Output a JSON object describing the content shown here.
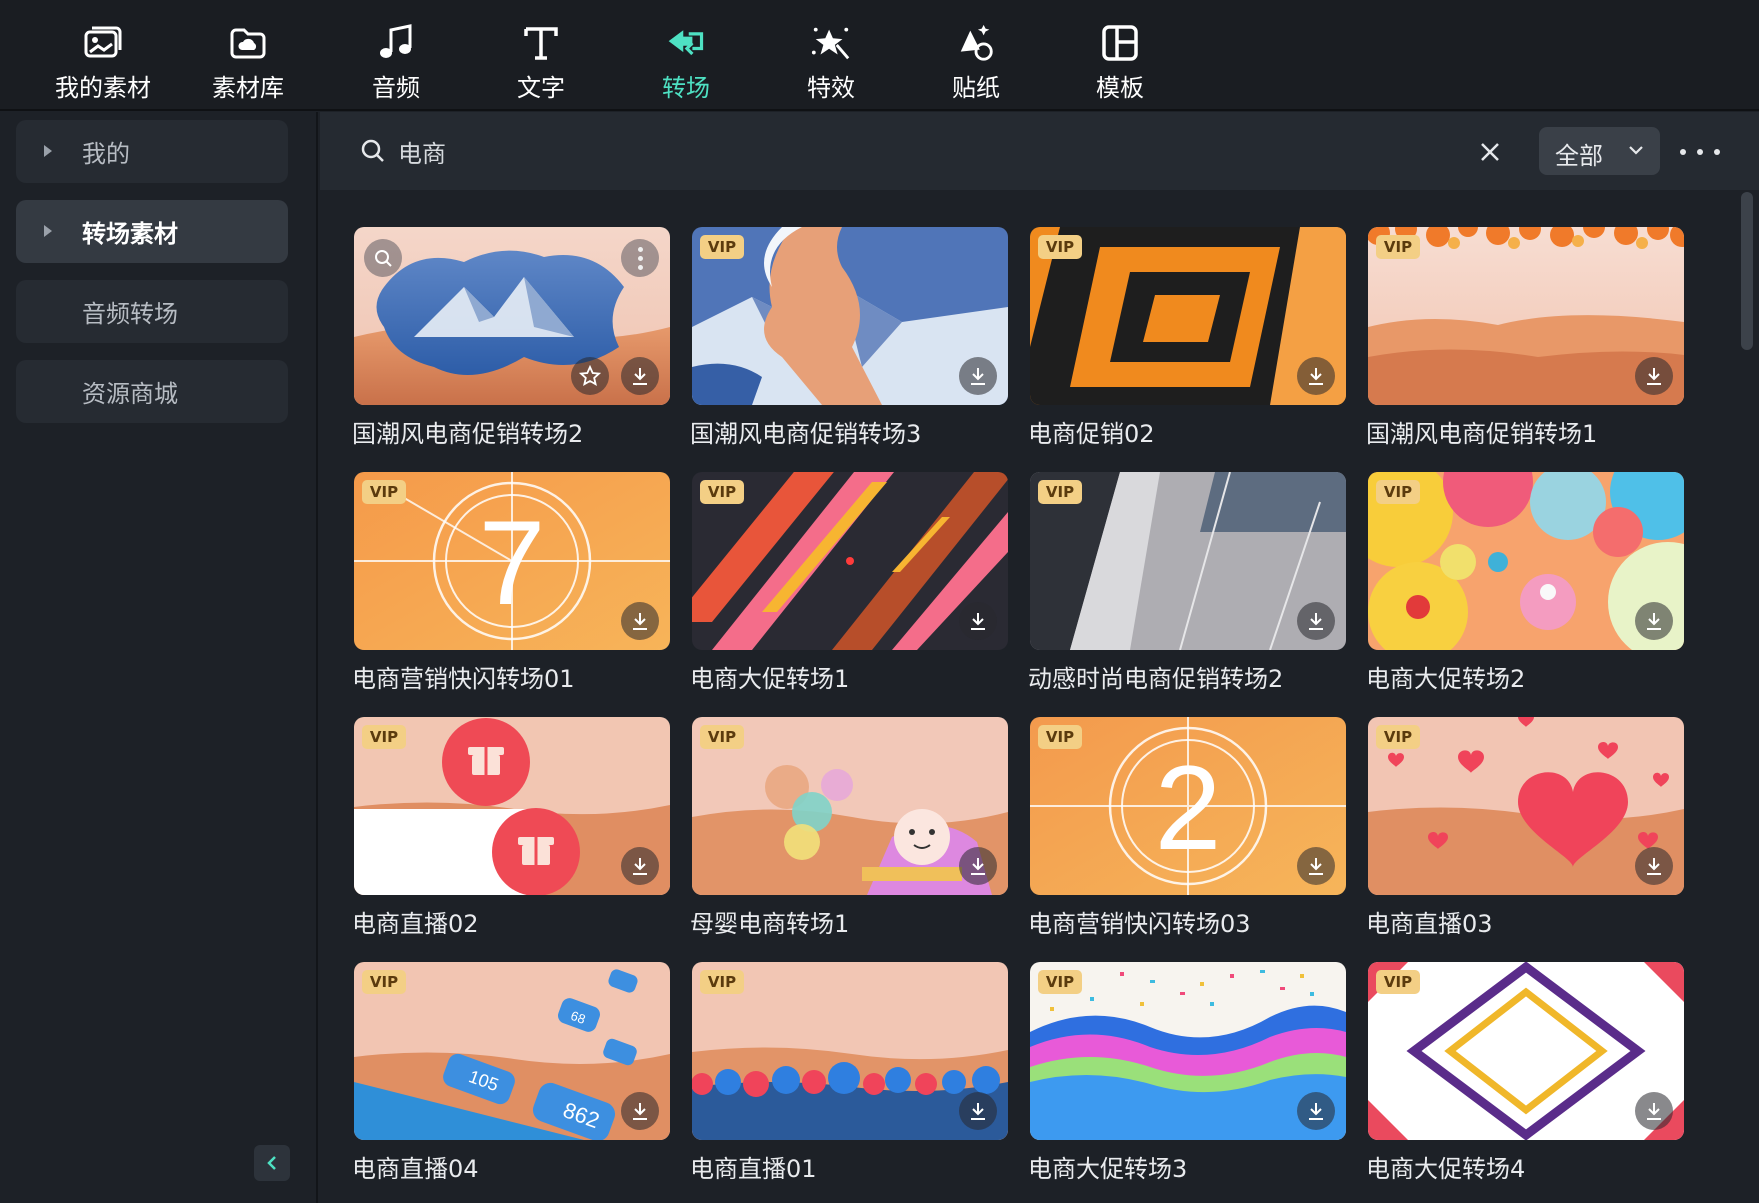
{
  "toolbar": {
    "tabs": [
      {
        "label": "我的素材",
        "icon": "my-media-icon"
      },
      {
        "label": "素材库",
        "icon": "stock-library-icon"
      },
      {
        "label": "音频",
        "icon": "music-note-icon"
      },
      {
        "label": "文字",
        "icon": "text-icon"
      },
      {
        "label": "转场",
        "icon": "transition-icon",
        "active": true
      },
      {
        "label": "特效",
        "icon": "magic-effects-icon"
      },
      {
        "label": "贴纸",
        "icon": "sticker-icon"
      },
      {
        "label": "模板",
        "icon": "template-icon"
      }
    ],
    "active_color": "#4ee1c3"
  },
  "sidebar": {
    "items": [
      {
        "label": "我的",
        "expandable": true
      },
      {
        "label": "转场素材",
        "expandable": true,
        "active": true
      },
      {
        "label": "音频转场"
      },
      {
        "label": "资源商城"
      }
    ]
  },
  "search": {
    "value": "电商",
    "filter": "全部"
  },
  "badge": {
    "vip": "VIP",
    "vip_color": "#f3cf85"
  },
  "items": [
    {
      "name": "国潮风电商促销转场2",
      "vip": false,
      "theme": "mountain-desert"
    },
    {
      "name": "国潮风电商促销转场3",
      "vip": true,
      "theme": "mountain-split"
    },
    {
      "name": "电商促销02",
      "vip": true,
      "theme": "orange-squares"
    },
    {
      "name": "国潮风电商促销转场1",
      "vip": true,
      "theme": "desert-flowers"
    },
    {
      "name": "电商营销快闪转场01",
      "vip": true,
      "theme": "countdown-7"
    },
    {
      "name": "电商大促转场1",
      "vip": true,
      "theme": "diagonal-stripes"
    },
    {
      "name": "动感时尚电商促销转场2",
      "vip": true,
      "theme": "grey-shards"
    },
    {
      "name": "电商大促转场2",
      "vip": true,
      "theme": "color-bubbles"
    },
    {
      "name": "电商直播02",
      "vip": true,
      "theme": "gift-boxes"
    },
    {
      "name": "母婴电商转场1",
      "vip": true,
      "theme": "baby-balloons"
    },
    {
      "name": "电商营销快闪转场03",
      "vip": true,
      "theme": "countdown-2"
    },
    {
      "name": "电商直播03",
      "vip": true,
      "theme": "hearts"
    },
    {
      "name": "电商直播04",
      "vip": true,
      "theme": "social-bubbles"
    },
    {
      "name": "电商直播01",
      "vip": true,
      "theme": "like-reactions"
    },
    {
      "name": "电商大促转场3",
      "vip": true,
      "theme": "confetti-waves"
    },
    {
      "name": "电商大促转场4",
      "vip": true,
      "theme": "diamond-frames"
    }
  ],
  "item_text": {
    "countdown_7": "7",
    "countdown_2": "2",
    "bubble_68": "68",
    "bubble_105": "105",
    "bubble_862": "862"
  }
}
